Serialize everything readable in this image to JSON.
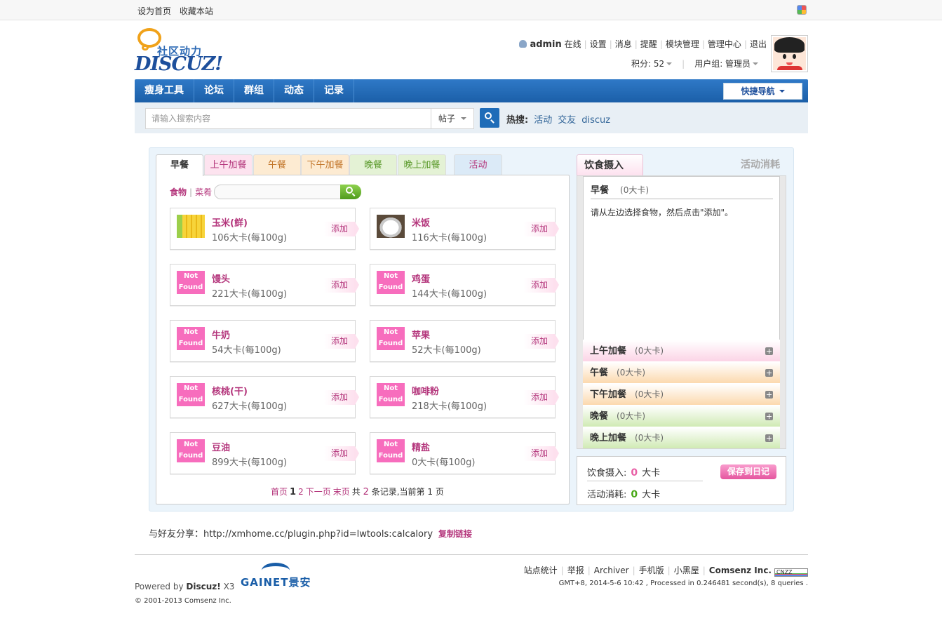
{
  "topbar": {
    "set_home": "设为首页",
    "bookmark": "收藏本站"
  },
  "logo": {
    "cn": "社区动力",
    "en": "DISCUZ!"
  },
  "userbar": {
    "username": "admin",
    "status": "在线",
    "links": [
      "设置",
      "消息",
      "提醒",
      "模块管理",
      "管理中心",
      "退出"
    ],
    "points_label": "积分: 52",
    "group_label": "用户组: 管理员"
  },
  "nav": {
    "items": [
      "瘦身工具",
      "论坛",
      "群组",
      "动态",
      "记录"
    ],
    "quick_nav": "快捷导航"
  },
  "search": {
    "placeholder": "请输入搜索内容",
    "type": "帖子",
    "hot_label": "热搜:",
    "hot": [
      "活动",
      "交友",
      "discuz"
    ]
  },
  "tabs": [
    {
      "label": "早餐",
      "bg": "#f3f3f3",
      "color": "#333"
    },
    {
      "label": "上午加餐",
      "bg": "#fde3ef",
      "color": "#b4367c"
    },
    {
      "label": "午餐",
      "bg": "#fdebd2",
      "color": "#c2762a"
    },
    {
      "label": "下午加餐",
      "bg": "#fdebd2",
      "color": "#c2762a"
    },
    {
      "label": "晚餐",
      "bg": "#e4f2d5",
      "color": "#5b9a2c"
    },
    {
      "label": "晚上加餐",
      "bg": "#e4f2d5",
      "color": "#5b9a2c"
    },
    {
      "label": "活动",
      "bg": "#dbeaf7",
      "color": "#b4367c"
    }
  ],
  "food_search": {
    "food": "食物",
    "dish": "菜肴"
  },
  "foods": [
    {
      "name": "玉米(鲜)",
      "cal": "106大卡(每100g)",
      "img": "corn"
    },
    {
      "name": "米饭",
      "cal": "116大卡(每100g)",
      "img": "rice"
    },
    {
      "name": "馒头",
      "cal": "221大卡(每100g)",
      "img": "nf"
    },
    {
      "name": "鸡蛋",
      "cal": "144大卡(每100g)",
      "img": "nf"
    },
    {
      "name": "牛奶",
      "cal": "54大卡(每100g)",
      "img": "nf"
    },
    {
      "name": "苹果",
      "cal": "52大卡(每100g)",
      "img": "nf"
    },
    {
      "name": "核桃(干)",
      "cal": "627大卡(每100g)",
      "img": "nf"
    },
    {
      "name": "咖啡粉",
      "cal": "218大卡(每100g)",
      "img": "nf"
    },
    {
      "name": "豆油",
      "cal": "899大卡(每100g)",
      "img": "nf"
    },
    {
      "name": "精盐",
      "cal": "0大卡(每100g)",
      "img": "nf"
    }
  ],
  "not_found": {
    "line1": "Not",
    "line2": "Found"
  },
  "add_label": "添加",
  "pager": {
    "first": "首页",
    "current": "1",
    "page2": "2",
    "next": "下一页",
    "last": "末页",
    "total_pre": "共",
    "total": "2",
    "total_post": "条记录,当前第",
    "page_now": "1",
    "page_post": "页"
  },
  "right": {
    "tab_intake": "饮食摄入",
    "tab_burn": "活动消耗",
    "breakfast": "早餐",
    "breakfast_kcal": "(0大卡)",
    "tip": "请从左边选择食物，然后点击\"添加\"。",
    "meals": [
      {
        "name": "上午加餐",
        "kcal": "(0大卡)",
        "bg": "linear-gradient(#fff,#fcd4e6)"
      },
      {
        "name": "午餐",
        "kcal": "(0大卡)",
        "bg": "linear-gradient(#fff,#fcd9ae)"
      },
      {
        "name": "下午加餐",
        "kcal": "(0大卡)",
        "bg": "linear-gradient(#fff,#fcd9ae)"
      },
      {
        "name": "晚餐",
        "kcal": "(0大卡)",
        "bg": "linear-gradient(#fff,#d0eab4)"
      },
      {
        "name": "晚上加餐",
        "kcal": "(0大卡)",
        "bg": "linear-gradient(#fff,#d0eab4)"
      }
    ]
  },
  "summary": {
    "intake_label": "饮食摄入:",
    "intake_val": "0",
    "unit": "大卡",
    "burn_label": "活动消耗:",
    "burn_val": "0",
    "save": "保存到日记"
  },
  "share": {
    "label": "与好友分享：http://xmhome.cc/plugin.php?id=lwtools:calcalory",
    "copy": "复制链接"
  },
  "footer": {
    "powered_pre": "Powered by",
    "powered_name": "Discuz!",
    "powered_ver": "X3",
    "gainet": "GAINET景安",
    "copyright": "© 2001-2013 Comsenz Inc.",
    "links": [
      "站点统计",
      "举报",
      "Archiver",
      "手机版",
      "小黑屋"
    ],
    "company": "Comsenz Inc.",
    "badge": "CNZZ",
    "gmt": "GMT+8, 2014-5-6 10:42 , Processed in 0.246481 second(s), 8 queries ."
  }
}
